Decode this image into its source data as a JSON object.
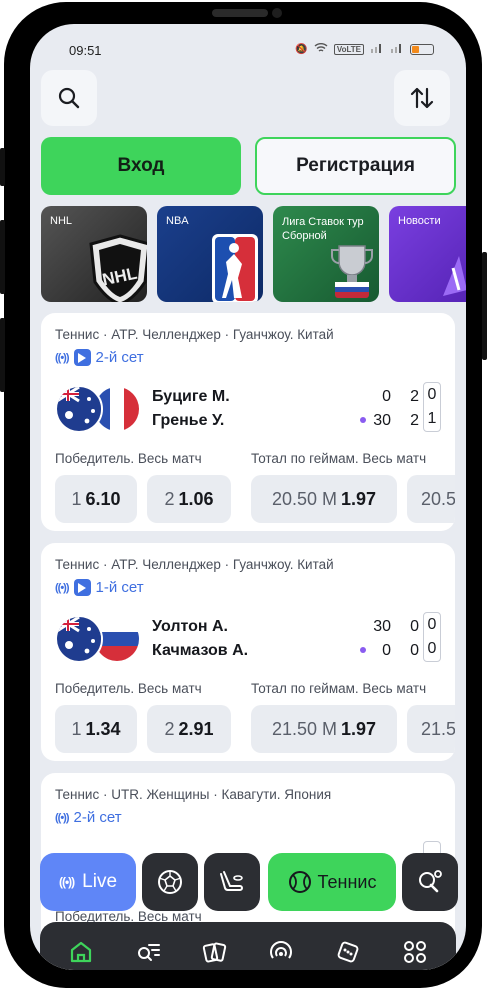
{
  "status": {
    "time": "09:51",
    "volte": "VoLTE"
  },
  "header": {
    "login_label": "Вход",
    "register_label": "Регистрация"
  },
  "stories": [
    {
      "label": "NHL"
    },
    {
      "label": "NBA"
    },
    {
      "label": "Лига Ставок тур Сборной"
    },
    {
      "label": "Новости"
    }
  ],
  "matches": [
    {
      "league": "Теннис · ATP. Челленджер · Гуанчжоу. Китай",
      "set": "2-й сет",
      "player1": "Буциге М.",
      "player2": "Гренье У.",
      "p1_scores": [
        "0",
        "2",
        "0"
      ],
      "p2_scores": [
        "30",
        "2",
        "1"
      ],
      "market1": "Победитель. Весь матч",
      "market2": "Тотал по геймам. Весь матч",
      "odds": [
        {
          "label": "1",
          "value": "6.10"
        },
        {
          "label": "2",
          "value": "1.06"
        },
        {
          "label": "20.50 М",
          "value": "1.97"
        },
        {
          "label": "20.5",
          "value": ""
        }
      ]
    },
    {
      "league": "Теннис · ATP. Челленджер · Гуанчжоу. Китай",
      "set": "1-й сет",
      "player1": "Уолтон А.",
      "player2": "Качмазов А.",
      "p1_scores": [
        "30",
        "0",
        "0"
      ],
      "p2_scores": [
        "0",
        "0",
        "0"
      ],
      "market1": "Победитель. Весь матч",
      "market2": "Тотал по геймам. Весь матч",
      "odds": [
        {
          "label": "1",
          "value": "1.34"
        },
        {
          "label": "2",
          "value": "2.91"
        },
        {
          "label": "21.50 М",
          "value": "1.97"
        },
        {
          "label": "21.5",
          "value": ""
        }
      ]
    },
    {
      "league": "Теннис · UTR. Женщины · Кавагути. Япония",
      "set": "2-й сет",
      "market1": "Победитель. Весь матч"
    }
  ],
  "chips": {
    "live_label": "Live",
    "tennis_label": "Теннис"
  },
  "colors": {
    "accent_green": "#3ed45b",
    "live_blue": "#5f86f7",
    "link_blue": "#3f6fe0",
    "serve_dot": "#8a5cf0"
  }
}
